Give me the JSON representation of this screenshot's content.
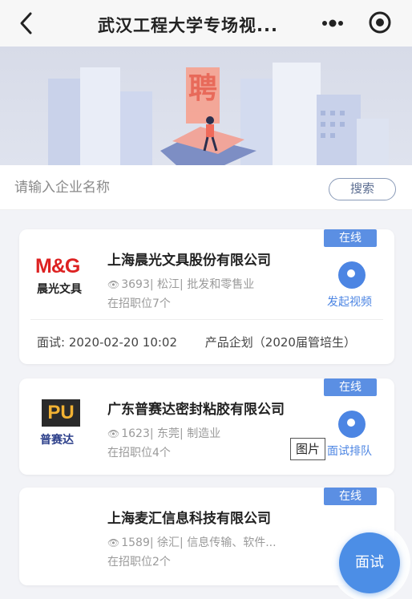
{
  "header": {
    "title": "武汉工程大学专场视...",
    "back_icon": "chevron-left-icon",
    "more_icon": "more-dots-icon",
    "target_icon": "target-icon"
  },
  "banner": {
    "badge_text": "聘"
  },
  "search": {
    "placeholder": "请输入企业名称",
    "button_label": "搜索"
  },
  "companies": [
    {
      "online_label": "在线",
      "logo_top": "M&G",
      "logo_bottom": "晨光文具",
      "name": "上海晨光文具股份有限公司",
      "meta": "3693| 松江| 批发和零售业",
      "jobs": "在招职位7个",
      "action_label": "发起视频",
      "interview_label": "面试:",
      "interview_time": "2020-02-20 10:02",
      "interview_position": "产品企划（2020届管培生）"
    },
    {
      "online_label": "在线",
      "logo_top": "PU",
      "logo_bottom": "普赛达",
      "name": "广东普赛达密封粘胶有限公司",
      "meta": "1623| 东莞| 制造业",
      "jobs": "在招职位4个",
      "action_label": "面试排队"
    },
    {
      "online_label": "在线",
      "name": "上海麦汇信息科技有限公司",
      "meta": "1589| 徐汇| 信息传输、软件...",
      "jobs": "在招职位2个"
    }
  ],
  "fab": {
    "label": "面试"
  },
  "image_tooltip": "图片",
  "colors": {
    "accent": "#4c85e3",
    "online_badge": "#5b8fe3",
    "muted_text": "#9a9a9a"
  }
}
